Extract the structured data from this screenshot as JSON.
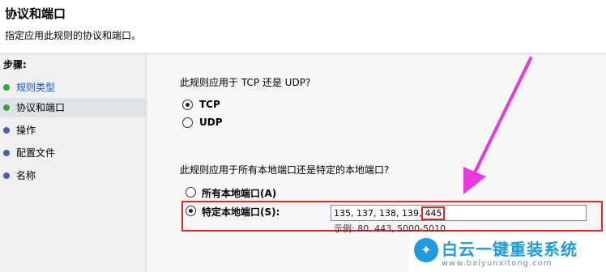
{
  "header": {
    "title": "协议和端口",
    "description": "指定应用此规则的协议和端口。"
  },
  "sidebar": {
    "title": "步骤:",
    "steps": [
      {
        "label": "规则类型",
        "status": "done",
        "color": "#3aa43a"
      },
      {
        "label": "协议和端口",
        "status": "current",
        "color": "#3aa43a"
      },
      {
        "label": "操作",
        "status": "pending",
        "color": "#4a5fb0"
      },
      {
        "label": "配置文件",
        "status": "pending",
        "color": "#4a5fb0"
      },
      {
        "label": "名称",
        "status": "pending",
        "color": "#4a5fb0"
      }
    ]
  },
  "main": {
    "protocol_question": "此规则应用于 TCP 还是 UDP?",
    "protocol_options": [
      {
        "label": "TCP",
        "checked": true
      },
      {
        "label": "UDP",
        "checked": false
      }
    ],
    "port_question": "此规则应用于所有本地端口还是特定的本地端口?",
    "port_options": [
      {
        "label": "所有本地端口(A)",
        "checked": false
      },
      {
        "label": "特定本地端口(S):",
        "checked": true
      }
    ],
    "ports_value_prefix": "135, 137, 138, 139,",
    "ports_value_highlight": "445",
    "ports_example": "示例: 80, 443, 5000-5010"
  },
  "annotations": {
    "highlight_color": "#e0262c",
    "arrow_color": "#e83adf"
  },
  "watermark": {
    "icon": "bird-icon",
    "title": "白云一键重装系统",
    "url": "www.baiyunxitong.com"
  }
}
